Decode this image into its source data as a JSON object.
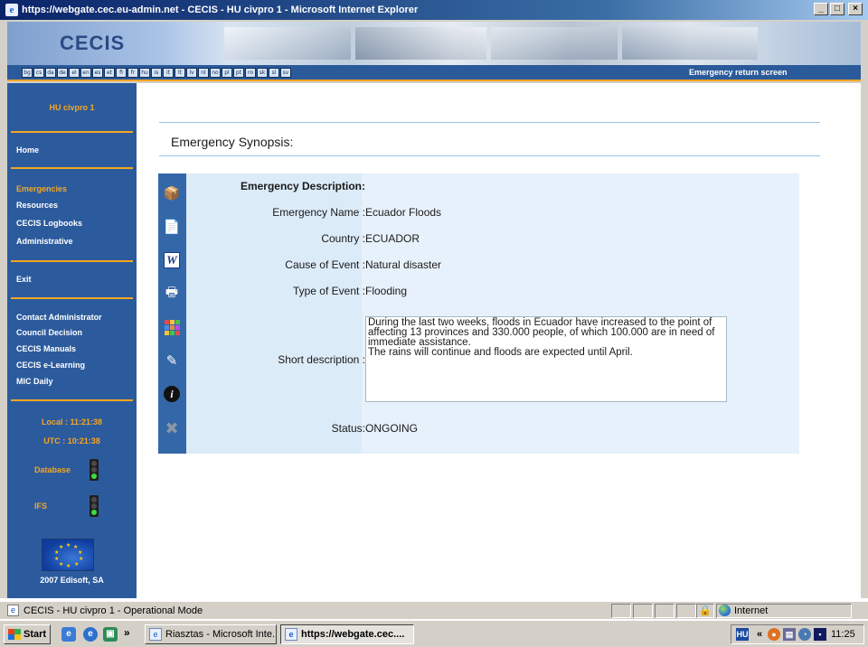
{
  "window": {
    "title": "https://webgate.cec.eu-admin.net - CECIS - HU civpro 1 - Microsoft Internet Explorer",
    "buttons": [
      "_",
      "□",
      "×"
    ]
  },
  "header": {
    "logo": "CECIS",
    "return_link": "Emergency return screen"
  },
  "languages": [
    "bg",
    "cs",
    "da",
    "de",
    "el",
    "en",
    "es",
    "et",
    "fi",
    "fr",
    "hu",
    "is",
    "it",
    "lt",
    "lv",
    "nl",
    "no",
    "pl",
    "pt",
    "ro",
    "sk",
    "sl",
    "sv"
  ],
  "sidebar": {
    "user": "HU civpro 1",
    "home": "Home",
    "nav": [
      {
        "label": "Emergencies",
        "active": true
      },
      {
        "label": "Resources",
        "active": false
      },
      {
        "label": "CECIS Logbooks",
        "active": false
      },
      {
        "label": "Administrative",
        "active": false
      }
    ],
    "exit": "Exit",
    "links": [
      "Contact Administrator",
      "Council Decision",
      "CECIS Manuals",
      "CECIS e-Learning",
      "MIC Daily"
    ],
    "local_time": "Local : 11:21:38",
    "utc_time": "UTC : 10:21:38",
    "database_label": "Database",
    "ifs_label": "IFS",
    "copyright": "2007 Edisoft, SA"
  },
  "main": {
    "title": "Emergency Synopsis:",
    "section_heading": "Emergency Description:",
    "fields": {
      "name_label": "Emergency Name :",
      "name_value": "Ecuador Floods",
      "country_label": "Country :",
      "country_value": "ECUADOR",
      "cause_label": "Cause of Event :",
      "cause_value": "Natural disaster",
      "type_label": "Type of Event :",
      "type_value": "Flooding",
      "short_desc_label": "Short description :",
      "short_desc_lines": [
        "During the last two weeks, floods in Ecuador have increased to the point of",
        "affecting 13 provinces and 330.000 people, of which 100.000 are in need of",
        "immediate assistance.",
        "The rains will continue and floods are expected until April."
      ],
      "status_label": "Status:",
      "status_value": "ONGOING"
    },
    "tools": [
      "package-icon",
      "document-icon",
      "word-icon",
      "printer-icon",
      "grid-icon",
      "edit-icon",
      "info-icon",
      "close-x-icon"
    ]
  },
  "statusbar": {
    "text": "CECIS - HU civpro 1 - Operational Mode",
    "zone": "Internet"
  },
  "taskbar": {
    "start": "Start",
    "tasks": [
      {
        "label": "Riasztas - Microsoft Inte...",
        "active": false
      },
      {
        "label": "https://webgate.cec....",
        "active": true
      }
    ],
    "chevron": "»",
    "tray_chevron": "«",
    "lang_indicator": "HU",
    "clock": "11:25"
  }
}
